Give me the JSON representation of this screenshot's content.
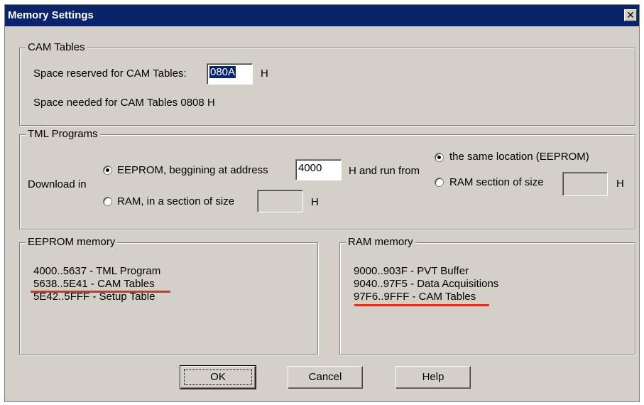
{
  "window": {
    "title": "Memory Settings",
    "close_glyph": "✕"
  },
  "cam_tables": {
    "legend": "CAM Tables",
    "reserved_label": "Space reserved for CAM Tables:",
    "reserved_value": "080A",
    "reserved_unit": "H",
    "needed_text": "Space needed for CAM Tables 0808 H"
  },
  "tml_programs": {
    "legend": "TML Programs",
    "download_in_label": "Download in",
    "eeprom_option": "EEPROM, beggining at address",
    "eeprom_address": "4000",
    "eeprom_unit_run": "H and run from",
    "ram_option": "RAM, in a section of size",
    "ram_size_value": "",
    "ram_unit": "H",
    "run_same_location": "the same location (EEPROM)",
    "run_ram_section": "RAM section of size",
    "run_ram_size_value": "",
    "run_ram_unit": "H",
    "selected_download": "eeprom",
    "selected_run": "same"
  },
  "eeprom_memory": {
    "legend": "EEPROM memory",
    "lines": [
      "4000..5637 - TML Program",
      "5638..5E41 - CAM Tables",
      "5E42..5FFF - Setup Table"
    ]
  },
  "ram_memory": {
    "legend": "RAM memory",
    "lines": [
      "9000..903F - PVT Buffer",
      "9040..97F5 - Data Acquisitions",
      "97F6..9FFF - CAM Tables"
    ]
  },
  "annotation_color": "#e0301e",
  "buttons": {
    "ok": "OK",
    "cancel": "Cancel",
    "help": "Help"
  }
}
